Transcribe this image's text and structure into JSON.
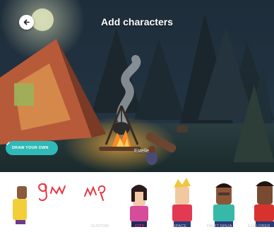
{
  "header": {
    "title": "Add characters"
  },
  "scene": {
    "draw_button_label": "DRAW YOUR OWN",
    "selected_character": "Estelle"
  },
  "tabs": [
    {
      "label": "CUSTOM",
      "active": false
    },
    {
      "label": "CITY",
      "active": true
    },
    {
      "label": "SPACE",
      "active": false
    },
    {
      "label": "FRUIT NINJA",
      "active": false
    },
    {
      "label": "EXPLORER",
      "active": false
    }
  ],
  "colors": {
    "accent": "#2fb9b7",
    "active_tab": "#e2297a",
    "scribble": "#e53845"
  }
}
